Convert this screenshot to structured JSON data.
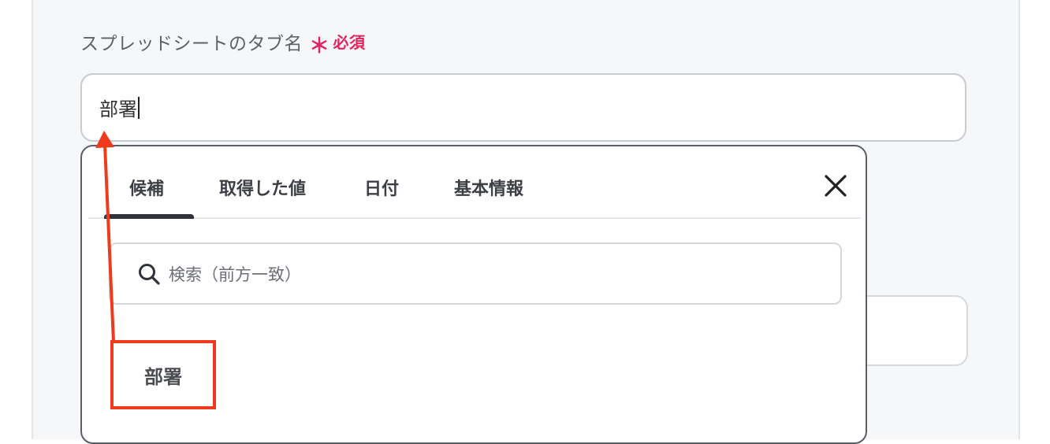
{
  "field": {
    "label": "スプレッドシートのタブ名",
    "required_mark": "＊",
    "required_text": "必須",
    "value": "部署"
  },
  "dropdown": {
    "tabs": [
      {
        "label": "候補",
        "active": true
      },
      {
        "label": "取得した値",
        "active": false
      },
      {
        "label": "日付",
        "active": false
      },
      {
        "label": "基本情報",
        "active": false
      }
    ],
    "close_icon": "close-icon",
    "search_placeholder": "検索（前方一致）",
    "search_icon": "search-icon",
    "suggestions": [
      "部署"
    ]
  },
  "colors": {
    "required": "#e0245e",
    "annotation": "#ee3a1d"
  }
}
